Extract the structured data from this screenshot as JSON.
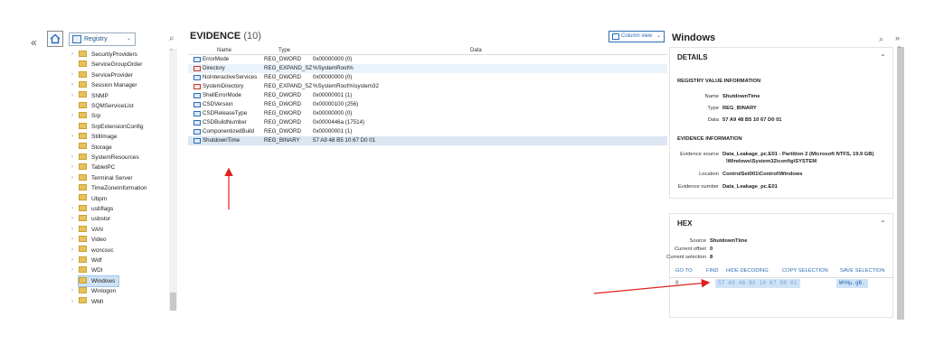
{
  "nav": {
    "back_icon": "«",
    "registry_label": "Registry",
    "search_icon": "⌕"
  },
  "tree": {
    "items": [
      {
        "label": "SecurityProviders",
        "expandable": true
      },
      {
        "label": "ServiceGroupOrder",
        "expandable": false
      },
      {
        "label": "ServiceProvider",
        "expandable": true
      },
      {
        "label": "Session Manager",
        "expandable": true
      },
      {
        "label": "SNMP",
        "expandable": true
      },
      {
        "label": "SQMServiceList",
        "expandable": false
      },
      {
        "label": "Srp",
        "expandable": true
      },
      {
        "label": "SrpExtensionConfig",
        "expandable": false
      },
      {
        "label": "StillImage",
        "expandable": true
      },
      {
        "label": "Storage",
        "expandable": false
      },
      {
        "label": "SystemResources",
        "expandable": true
      },
      {
        "label": "TabletPC",
        "expandable": true
      },
      {
        "label": "Terminal Server",
        "expandable": true
      },
      {
        "label": "TimeZoneInformation",
        "expandable": false
      },
      {
        "label": "Ubpm",
        "expandable": false
      },
      {
        "label": "usbflags",
        "expandable": true
      },
      {
        "label": "usbstor",
        "expandable": true
      },
      {
        "label": "VAN",
        "expandable": true
      },
      {
        "label": "Video",
        "expandable": true
      },
      {
        "label": "wcncsvc",
        "expandable": true
      },
      {
        "label": "Wdf",
        "expandable": true
      },
      {
        "label": "WDI",
        "expandable": true
      },
      {
        "label": "Windows",
        "expandable": false,
        "selected": true
      },
      {
        "label": "Winlogon",
        "expandable": true
      },
      {
        "label": "WMI",
        "expandable": true
      }
    ]
  },
  "evidence": {
    "title": "EVIDENCE",
    "count": "(10)",
    "column_view_label": "Column view",
    "columns": [
      "Name",
      "Type",
      "Data"
    ],
    "rows": [
      {
        "name": "ErrorMode",
        "type": "REG_DWORD",
        "data": "0x00000000 (0)",
        "kind": "dword"
      },
      {
        "name": "Directory",
        "type": "REG_EXPAND_SZ",
        "data": "%SystemRoot%",
        "kind": "string"
      },
      {
        "name": "NoInteractiveServices",
        "type": "REG_DWORD",
        "data": "0x00000000 (0)",
        "kind": "dword"
      },
      {
        "name": "SystemDirectory",
        "type": "REG_EXPAND_SZ",
        "data": "%SystemRoot%\\system32",
        "kind": "string"
      },
      {
        "name": "ShellErrorMode",
        "type": "REG_DWORD",
        "data": "0x00000001 (1)",
        "kind": "dword"
      },
      {
        "name": "CSDVersion",
        "type": "REG_DWORD",
        "data": "0x00000100 (256)",
        "kind": "dword"
      },
      {
        "name": "CSDReleaseType",
        "type": "REG_DWORD",
        "data": "0x00000000 (0)",
        "kind": "dword"
      },
      {
        "name": "CSDBuildNumber",
        "type": "REG_DWORD",
        "data": "0x0000446a (17514)",
        "kind": "dword"
      },
      {
        "name": "ComponentizedBuild",
        "type": "REG_DWORD",
        "data": "0x00000001 (1)",
        "kind": "dword"
      },
      {
        "name": "ShutdownTime",
        "type": "REG_BINARY",
        "data": "57 A9 48 B5 10 67 D0 01",
        "kind": "binary"
      }
    ]
  },
  "panel": {
    "title": "Windows",
    "search_icon": "⌕",
    "collapse_icon": "»",
    "details": {
      "heading": "DETAILS",
      "reg_section": "REGISTRY VALUE INFORMATION",
      "name_label": "Name",
      "name_value": "ShutdownTime",
      "type_label": "Type",
      "type_value": "REG_BINARY",
      "data_label": "Data",
      "data_value": "57 A9 48 B5 10 67 D0 01",
      "ev_section": "EVIDENCE INFORMATION",
      "source_label": "Evidence source",
      "source_value_1": "Data_Leakage_pc.E01 - Partition 2 (Microsoft NTFS, 19.9 GB)",
      "source_value_2": "\\Windows\\System32\\config\\SYSTEM",
      "location_label": "Location",
      "location_value": "ControlSet001\\Control\\Windows",
      "evnum_label": "Evidence number",
      "evnum_value": "Data_Leakage_pc.E01"
    },
    "hex": {
      "heading": "HEX",
      "source_label": "Source",
      "source_value": "ShutdownTime",
      "offset_label": "Current offset",
      "offset_value": "0",
      "selection_label": "Current selection",
      "selection_value": "8",
      "actions": [
        "GO TO",
        "FIND",
        "HIDE DECODING",
        "COPY SELECTION",
        "SAVE SELECTION"
      ],
      "offset_row": "0",
      "bytes": "57 A9 48 B5 10 67 D0 01",
      "ascii": "W©Hµ.gÐ."
    }
  },
  "colors": {
    "accent": "#2c6db5",
    "selection": "#cfe3f7",
    "arrow": "#e02020"
  }
}
